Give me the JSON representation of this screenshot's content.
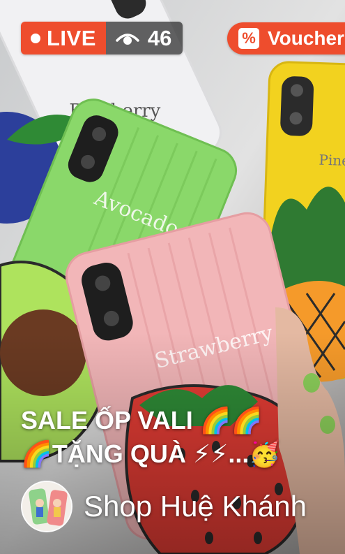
{
  "stream": {
    "live_label": "LIVE",
    "viewer_count": "46",
    "voucher_label": "Voucher",
    "voucher_icon_glyph": "%",
    "title_line1": "SALE ỐP VALI 🌈🌈",
    "title_line2": "🌈TẶNG QUÀ ⚡⚡...🥳",
    "shop_name": "Shop Huệ Khánh"
  },
  "colors": {
    "brand": "#ee4d2d",
    "viewer_pill": "#282828"
  },
  "icons": {
    "eye": "eye-icon",
    "voucher": "percent-icon"
  }
}
